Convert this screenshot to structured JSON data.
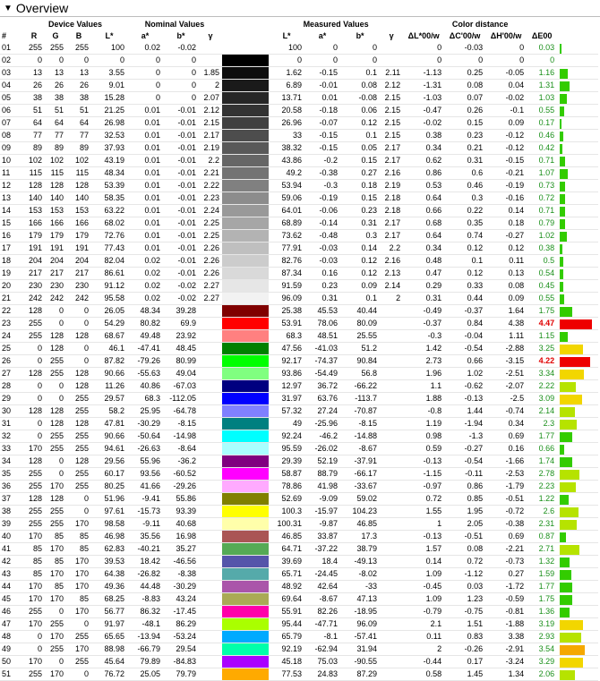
{
  "header": {
    "title": "Overview",
    "toggle_icon": "triangle-down-icon"
  },
  "groups": {
    "device": "Device Values",
    "nominal": "Nominal Values",
    "measured": "Measured Values",
    "distance": "Color distance"
  },
  "columns": [
    "#",
    "R",
    "G",
    "B",
    "L*",
    "a*",
    "b*",
    "γ",
    "",
    "L*",
    "a*",
    "b*",
    "γ",
    "ΔL*00/w",
    "ΔC'00/w",
    "ΔH'00/w",
    "ΔE00",
    ""
  ],
  "colors": {
    "bar_green": "#33cc00",
    "bar_yellowgreen": "#b6e300",
    "bar_yellow": "#f2d600",
    "bar_orange": "#f5a800",
    "bar_red": "#ee0000",
    "highlight": "#e00000"
  },
  "rows": [
    {
      "id": "01",
      "r": "255",
      "g": "255",
      "b": "255",
      "nl": "100",
      "na": "0.02",
      "nb": "-0.02",
      "ng": "",
      "swatch": "#ffffff",
      "ml": "100",
      "ma": "0",
      "mb": "0",
      "mg": "",
      "dl": "0",
      "dc": "-0.03",
      "dh": "0",
      "de": "0.03"
    },
    {
      "id": "02",
      "r": "0",
      "g": "0",
      "b": "0",
      "nl": "0",
      "na": "0",
      "nb": "0",
      "ng": "",
      "swatch": "#000000",
      "ml": "0",
      "ma": "0",
      "mb": "0",
      "mg": "",
      "dl": "0",
      "dc": "0",
      "dh": "0",
      "de": "0"
    },
    {
      "id": "03",
      "r": "13",
      "g": "13",
      "b": "13",
      "nl": "3.55",
      "na": "0",
      "nb": "0",
      "ng": "1.85",
      "swatch": "#0d0d0d",
      "ml": "1.62",
      "ma": "-0.15",
      "mb": "0.1",
      "mg": "2.11",
      "dl": "-1.13",
      "dc": "0.25",
      "dh": "-0.05",
      "de": "1.16"
    },
    {
      "id": "04",
      "r": "26",
      "g": "26",
      "b": "26",
      "nl": "9.01",
      "na": "0",
      "nb": "0",
      "ng": "2",
      "swatch": "#1a1a1a",
      "ml": "6.89",
      "ma": "-0.01",
      "mb": "0.08",
      "mg": "2.12",
      "dl": "-1.31",
      "dc": "0.08",
      "dh": "0.04",
      "de": "1.31"
    },
    {
      "id": "05",
      "r": "38",
      "g": "38",
      "b": "38",
      "nl": "15.28",
      "na": "0",
      "nb": "0",
      "ng": "2.07",
      "swatch": "#262626",
      "ml": "13.71",
      "ma": "0.01",
      "mb": "-0.08",
      "mg": "2.15",
      "dl": "-1.03",
      "dc": "0.07",
      "dh": "-0.02",
      "de": "1.03"
    },
    {
      "id": "06",
      "r": "51",
      "g": "51",
      "b": "51",
      "nl": "21.25",
      "na": "0.01",
      "nb": "-0.01",
      "ng": "2.12",
      "swatch": "#333333",
      "ml": "20.58",
      "ma": "-0.18",
      "mb": "0.06",
      "mg": "2.15",
      "dl": "-0.47",
      "dc": "0.26",
      "dh": "-0.1",
      "de": "0.55"
    },
    {
      "id": "07",
      "r": "64",
      "g": "64",
      "b": "64",
      "nl": "26.98",
      "na": "0.01",
      "nb": "-0.01",
      "ng": "2.15",
      "swatch": "#404040",
      "ml": "26.96",
      "ma": "-0.07",
      "mb": "0.12",
      "mg": "2.15",
      "dl": "-0.02",
      "dc": "0.15",
      "dh": "0.09",
      "de": "0.17"
    },
    {
      "id": "08",
      "r": "77",
      "g": "77",
      "b": "77",
      "nl": "32.53",
      "na": "0.01",
      "nb": "-0.01",
      "ng": "2.17",
      "swatch": "#4d4d4d",
      "ml": "33",
      "ma": "-0.15",
      "mb": "0.1",
      "mg": "2.15",
      "dl": "0.38",
      "dc": "0.23",
      "dh": "-0.12",
      "de": "0.46"
    },
    {
      "id": "09",
      "r": "89",
      "g": "89",
      "b": "89",
      "nl": "37.93",
      "na": "0.01",
      "nb": "-0.01",
      "ng": "2.19",
      "swatch": "#595959",
      "ml": "38.32",
      "ma": "-0.15",
      "mb": "0.05",
      "mg": "2.17",
      "dl": "0.34",
      "dc": "0.21",
      "dh": "-0.12",
      "de": "0.42"
    },
    {
      "id": "10",
      "r": "102",
      "g": "102",
      "b": "102",
      "nl": "43.19",
      "na": "0.01",
      "nb": "-0.01",
      "ng": "2.2",
      "swatch": "#666666",
      "ml": "43.86",
      "ma": "-0.2",
      "mb": "0.15",
      "mg": "2.17",
      "dl": "0.62",
      "dc": "0.31",
      "dh": "-0.15",
      "de": "0.71"
    },
    {
      "id": "11",
      "r": "115",
      "g": "115",
      "b": "115",
      "nl": "48.34",
      "na": "0.01",
      "nb": "-0.01",
      "ng": "2.21",
      "swatch": "#737373",
      "ml": "49.2",
      "ma": "-0.38",
      "mb": "0.27",
      "mg": "2.16",
      "dl": "0.86",
      "dc": "0.6",
      "dh": "-0.21",
      "de": "1.07"
    },
    {
      "id": "12",
      "r": "128",
      "g": "128",
      "b": "128",
      "nl": "53.39",
      "na": "0.01",
      "nb": "-0.01",
      "ng": "2.22",
      "swatch": "#808080",
      "ml": "53.94",
      "ma": "-0.3",
      "mb": "0.18",
      "mg": "2.19",
      "dl": "0.53",
      "dc": "0.46",
      "dh": "-0.19",
      "de": "0.73"
    },
    {
      "id": "13",
      "r": "140",
      "g": "140",
      "b": "140",
      "nl": "58.35",
      "na": "0.01",
      "nb": "-0.01",
      "ng": "2.23",
      "swatch": "#8c8c8c",
      "ml": "59.06",
      "ma": "-0.19",
      "mb": "0.15",
      "mg": "2.18",
      "dl": "0.64",
      "dc": "0.3",
      "dh": "-0.16",
      "de": "0.72"
    },
    {
      "id": "14",
      "r": "153",
      "g": "153",
      "b": "153",
      "nl": "63.22",
      "na": "0.01",
      "nb": "-0.01",
      "ng": "2.24",
      "swatch": "#999999",
      "ml": "64.01",
      "ma": "-0.06",
      "mb": "0.23",
      "mg": "2.18",
      "dl": "0.66",
      "dc": "0.22",
      "dh": "0.14",
      "de": "0.71"
    },
    {
      "id": "15",
      "r": "166",
      "g": "166",
      "b": "166",
      "nl": "68.02",
      "na": "0.01",
      "nb": "-0.01",
      "ng": "2.25",
      "swatch": "#a6a6a6",
      "ml": "68.89",
      "ma": "-0.14",
      "mb": "0.31",
      "mg": "2.17",
      "dl": "0.68",
      "dc": "0.35",
      "dh": "0.18",
      "de": "0.79"
    },
    {
      "id": "16",
      "r": "179",
      "g": "179",
      "b": "179",
      "nl": "72.76",
      "na": "0.01",
      "nb": "-0.01",
      "ng": "2.25",
      "swatch": "#b3b3b3",
      "ml": "73.62",
      "ma": "-0.48",
      "mb": "0.3",
      "mg": "2.17",
      "dl": "0.64",
      "dc": "0.74",
      "dh": "-0.27",
      "de": "1.02"
    },
    {
      "id": "17",
      "r": "191",
      "g": "191",
      "b": "191",
      "nl": "77.43",
      "na": "0.01",
      "nb": "-0.01",
      "ng": "2.26",
      "swatch": "#bfbfbf",
      "ml": "77.91",
      "ma": "-0.03",
      "mb": "0.14",
      "mg": "2.2",
      "dl": "0.34",
      "dc": "0.12",
      "dh": "0.12",
      "de": "0.38"
    },
    {
      "id": "18",
      "r": "204",
      "g": "204",
      "b": "204",
      "nl": "82.04",
      "na": "0.02",
      "nb": "-0.01",
      "ng": "2.26",
      "swatch": "#cccccc",
      "ml": "82.76",
      "ma": "-0.03",
      "mb": "0.12",
      "mg": "2.16",
      "dl": "0.48",
      "dc": "0.1",
      "dh": "0.11",
      "de": "0.5"
    },
    {
      "id": "19",
      "r": "217",
      "g": "217",
      "b": "217",
      "nl": "86.61",
      "na": "0.02",
      "nb": "-0.01",
      "ng": "2.26",
      "swatch": "#d9d9d9",
      "ml": "87.34",
      "ma": "0.16",
      "mb": "0.12",
      "mg": "2.13",
      "dl": "0.47",
      "dc": "0.12",
      "dh": "0.13",
      "de": "0.54"
    },
    {
      "id": "20",
      "r": "230",
      "g": "230",
      "b": "230",
      "nl": "91.12",
      "na": "0.02",
      "nb": "-0.02",
      "ng": "2.27",
      "swatch": "#e6e6e6",
      "ml": "91.59",
      "ma": "0.23",
      "mb": "0.09",
      "mg": "2.14",
      "dl": "0.29",
      "dc": "0.33",
      "dh": "0.08",
      "de": "0.45"
    },
    {
      "id": "21",
      "r": "242",
      "g": "242",
      "b": "242",
      "nl": "95.58",
      "na": "0.02",
      "nb": "-0.02",
      "ng": "2.27",
      "swatch": "#f2f2f2",
      "ml": "96.09",
      "ma": "0.31",
      "mb": "0.1",
      "mg": "2",
      "dl": "0.31",
      "dc": "0.44",
      "dh": "0.09",
      "de": "0.55"
    },
    {
      "id": "22",
      "r": "128",
      "g": "0",
      "b": "0",
      "nl": "26.05",
      "na": "48.34",
      "nb": "39.28",
      "ng": "",
      "swatch": "#800000",
      "ml": "25.38",
      "ma": "45.53",
      "mb": "40.44",
      "mg": "",
      "dl": "-0.49",
      "dc": "-0.37",
      "dh": "1.64",
      "de": "1.75"
    },
    {
      "id": "23",
      "r": "255",
      "g": "0",
      "b": "0",
      "nl": "54.29",
      "na": "80.82",
      "nb": "69.9",
      "ng": "",
      "swatch": "#ff0000",
      "ml": "53.91",
      "ma": "78.06",
      "mb": "80.09",
      "mg": "",
      "dl": "-0.37",
      "dc": "0.84",
      "dh": "4.38",
      "de": "4.47"
    },
    {
      "id": "24",
      "r": "255",
      "g": "128",
      "b": "128",
      "nl": "68.67",
      "na": "49.48",
      "nb": "23.92",
      "ng": "",
      "swatch": "#ff8080",
      "ml": "68.3",
      "ma": "48.51",
      "mb": "25.55",
      "mg": "",
      "dl": "-0.3",
      "dc": "-0.04",
      "dh": "1.11",
      "de": "1.15"
    },
    {
      "id": "25",
      "r": "0",
      "g": "128",
      "b": "0",
      "nl": "46.1",
      "na": "-47.41",
      "nb": "48.45",
      "ng": "",
      "swatch": "#008000",
      "ml": "47.56",
      "ma": "-41.03",
      "mb": "51.2",
      "mg": "",
      "dl": "1.42",
      "dc": "-0.54",
      "dh": "-2.88",
      "de": "3.25"
    },
    {
      "id": "26",
      "r": "0",
      "g": "255",
      "b": "0",
      "nl": "87.82",
      "na": "-79.26",
      "nb": "80.99",
      "ng": "",
      "swatch": "#00ff00",
      "ml": "92.17",
      "ma": "-74.37",
      "mb": "90.84",
      "mg": "",
      "dl": "2.73",
      "dc": "0.66",
      "dh": "-3.15",
      "de": "4.22"
    },
    {
      "id": "27",
      "r": "128",
      "g": "255",
      "b": "128",
      "nl": "90.66",
      "na": "-55.63",
      "nb": "49.04",
      "ng": "",
      "swatch": "#80ff80",
      "ml": "93.86",
      "ma": "-54.49",
      "mb": "56.8",
      "mg": "",
      "dl": "1.96",
      "dc": "1.02",
      "dh": "-2.51",
      "de": "3.34"
    },
    {
      "id": "28",
      "r": "0",
      "g": "0",
      "b": "128",
      "nl": "11.26",
      "na": "40.86",
      "nb": "-67.03",
      "ng": "",
      "swatch": "#000080",
      "ml": "12.97",
      "ma": "36.72",
      "mb": "-66.22",
      "mg": "",
      "dl": "1.1",
      "dc": "-0.62",
      "dh": "-2.07",
      "de": "2.22"
    },
    {
      "id": "29",
      "r": "0",
      "g": "0",
      "b": "255",
      "nl": "29.57",
      "na": "68.3",
      "nb": "-112.05",
      "ng": "",
      "swatch": "#0000ff",
      "ml": "31.97",
      "ma": "63.76",
      "mb": "-113.7",
      "mg": "",
      "dl": "1.88",
      "dc": "-0.13",
      "dh": "-2.5",
      "de": "3.09"
    },
    {
      "id": "30",
      "r": "128",
      "g": "128",
      "b": "255",
      "nl": "58.2",
      "na": "25.95",
      "nb": "-64.78",
      "ng": "",
      "swatch": "#8080ff",
      "ml": "57.32",
      "ma": "27.24",
      "mb": "-70.87",
      "mg": "",
      "dl": "-0.8",
      "dc": "1.44",
      "dh": "-0.74",
      "de": "2.14"
    },
    {
      "id": "31",
      "r": "0",
      "g": "128",
      "b": "128",
      "nl": "47.81",
      "na": "-30.29",
      "nb": "-8.15",
      "ng": "",
      "swatch": "#008080",
      "ml": "49",
      "ma": "-25.96",
      "mb": "-8.15",
      "mg": "",
      "dl": "1.19",
      "dc": "-1.94",
      "dh": "0.34",
      "de": "2.3"
    },
    {
      "id": "32",
      "r": "0",
      "g": "255",
      "b": "255",
      "nl": "90.66",
      "na": "-50.64",
      "nb": "-14.98",
      "ng": "",
      "swatch": "#00ffff",
      "ml": "92.24",
      "ma": "-46.2",
      "mb": "-14.88",
      "mg": "",
      "dl": "0.98",
      "dc": "-1.3",
      "dh": "0.69",
      "de": "1.77"
    },
    {
      "id": "33",
      "r": "170",
      "g": "255",
      "b": "255",
      "nl": "94.61",
      "na": "-26.63",
      "nb": "-8.64",
      "ng": "",
      "swatch": "#aaffff",
      "ml": "95.59",
      "ma": "-26.02",
      "mb": "-8.67",
      "mg": "",
      "dl": "0.59",
      "dc": "-0.27",
      "dh": "0.16",
      "de": "0.66"
    },
    {
      "id": "34",
      "r": "128",
      "g": "0",
      "b": "128",
      "nl": "29.56",
      "na": "55.96",
      "nb": "-36.2",
      "ng": "",
      "swatch": "#800080",
      "ml": "29.39",
      "ma": "52.19",
      "mb": "-37.91",
      "mg": "",
      "dl": "-0.13",
      "dc": "-0.54",
      "dh": "-1.66",
      "de": "1.74"
    },
    {
      "id": "35",
      "r": "255",
      "g": "0",
      "b": "255",
      "nl": "60.17",
      "na": "93.56",
      "nb": "-60.52",
      "ng": "",
      "swatch": "#ff00ff",
      "ml": "58.87",
      "ma": "88.79",
      "mb": "-66.17",
      "mg": "",
      "dl": "-1.15",
      "dc": "-0.11",
      "dh": "-2.53",
      "de": "2.78"
    },
    {
      "id": "36",
      "r": "255",
      "g": "170",
      "b": "255",
      "nl": "80.25",
      "na": "41.66",
      "nb": "-29.26",
      "ng": "",
      "swatch": "#ffaaff",
      "ml": "78.86",
      "ma": "41.98",
      "mb": "-33.67",
      "mg": "",
      "dl": "-0.97",
      "dc": "0.86",
      "dh": "-1.79",
      "de": "2.23"
    },
    {
      "id": "37",
      "r": "128",
      "g": "128",
      "b": "0",
      "nl": "51.96",
      "na": "-9.41",
      "nb": "55.86",
      "ng": "",
      "swatch": "#808000",
      "ml": "52.69",
      "ma": "-9.09",
      "mb": "59.02",
      "mg": "",
      "dl": "0.72",
      "dc": "0.85",
      "dh": "-0.51",
      "de": "1.22"
    },
    {
      "id": "38",
      "r": "255",
      "g": "255",
      "b": "0",
      "nl": "97.61",
      "na": "-15.73",
      "nb": "93.39",
      "ng": "",
      "swatch": "#ffff00",
      "ml": "100.3",
      "ma": "-15.97",
      "mb": "104.23",
      "mg": "",
      "dl": "1.55",
      "dc": "1.95",
      "dh": "-0.72",
      "de": "2.6"
    },
    {
      "id": "39",
      "r": "255",
      "g": "255",
      "b": "170",
      "nl": "98.58",
      "na": "-9.11",
      "nb": "40.68",
      "ng": "",
      "swatch": "#ffffaa",
      "ml": "100.31",
      "ma": "-9.87",
      "mb": "46.85",
      "mg": "",
      "dl": "1",
      "dc": "2.05",
      "dh": "-0.38",
      "de": "2.31"
    },
    {
      "id": "40",
      "r": "170",
      "g": "85",
      "b": "85",
      "nl": "46.98",
      "na": "35.56",
      "nb": "16.98",
      "ng": "",
      "swatch": "#aa5555",
      "ml": "46.85",
      "ma": "33.87",
      "mb": "17.3",
      "mg": "",
      "dl": "-0.13",
      "dc": "-0.51",
      "dh": "0.69",
      "de": "0.87"
    },
    {
      "id": "41",
      "r": "85",
      "g": "170",
      "b": "85",
      "nl": "62.83",
      "na": "-40.21",
      "nb": "35.27",
      "ng": "",
      "swatch": "#55aa55",
      "ml": "64.71",
      "ma": "-37.22",
      "mb": "38.79",
      "mg": "",
      "dl": "1.57",
      "dc": "0.08",
      "dh": "-2.21",
      "de": "2.71"
    },
    {
      "id": "42",
      "r": "85",
      "g": "85",
      "b": "170",
      "nl": "39.53",
      "na": "18.42",
      "nb": "-46.56",
      "ng": "",
      "swatch": "#5555aa",
      "ml": "39.69",
      "ma": "18.4",
      "mb": "-49.13",
      "mg": "",
      "dl": "0.14",
      "dc": "0.72",
      "dh": "-0.73",
      "de": "1.32"
    },
    {
      "id": "43",
      "r": "85",
      "g": "170",
      "b": "170",
      "nl": "64.38",
      "na": "-26.82",
      "nb": "-8.38",
      "ng": "",
      "swatch": "#55aaaa",
      "ml": "65.71",
      "ma": "-24.45",
      "mb": "-8.02",
      "mg": "",
      "dl": "1.09",
      "dc": "-1.12",
      "dh": "0.27",
      "de": "1.59"
    },
    {
      "id": "44",
      "r": "170",
      "g": "85",
      "b": "170",
      "nl": "49.36",
      "na": "44.48",
      "nb": "-30.29",
      "ng": "",
      "swatch": "#aa55aa",
      "ml": "48.92",
      "ma": "42.64",
      "mb": "-33",
      "mg": "",
      "dl": "-0.45",
      "dc": "0.03",
      "dh": "-1.72",
      "de": "1.77"
    },
    {
      "id": "45",
      "r": "170",
      "g": "170",
      "b": "85",
      "nl": "68.25",
      "na": "-8.83",
      "nb": "43.24",
      "ng": "",
      "swatch": "#aaaa55",
      "ml": "69.64",
      "ma": "-8.67",
      "mb": "47.13",
      "mg": "",
      "dl": "1.09",
      "dc": "1.23",
      "dh": "-0.59",
      "de": "1.75"
    },
    {
      "id": "46",
      "r": "255",
      "g": "0",
      "b": "170",
      "nl": "56.77",
      "na": "86.32",
      "nb": "-17.45",
      "ng": "",
      "swatch": "#ff00aa",
      "ml": "55.91",
      "ma": "82.26",
      "mb": "-18.95",
      "mg": "",
      "dl": "-0.79",
      "dc": "-0.75",
      "dh": "-0.81",
      "de": "1.36"
    },
    {
      "id": "47",
      "r": "170",
      "g": "255",
      "b": "0",
      "nl": "91.97",
      "na": "-48.1",
      "nb": "86.29",
      "ng": "",
      "swatch": "#aaff00",
      "ml": "95.44",
      "ma": "-47.71",
      "mb": "96.09",
      "mg": "",
      "dl": "2.1",
      "dc": "1.51",
      "dh": "-1.88",
      "de": "3.19"
    },
    {
      "id": "48",
      "r": "0",
      "g": "170",
      "b": "255",
      "nl": "65.65",
      "na": "-13.94",
      "nb": "-53.24",
      "ng": "",
      "swatch": "#00aaff",
      "ml": "65.79",
      "ma": "-8.1",
      "mb": "-57.41",
      "mg": "",
      "dl": "0.11",
      "dc": "0.83",
      "dh": "3.38",
      "de": "2.93"
    },
    {
      "id": "49",
      "r": "0",
      "g": "255",
      "b": "170",
      "nl": "88.98",
      "na": "-66.79",
      "nb": "29.54",
      "ng": "",
      "swatch": "#00ffaa",
      "ml": "92.19",
      "ma": "-62.94",
      "mb": "31.94",
      "mg": "",
      "dl": "2",
      "dc": "-0.26",
      "dh": "-2.91",
      "de": "3.54"
    },
    {
      "id": "50",
      "r": "170",
      "g": "0",
      "b": "255",
      "nl": "45.64",
      "na": "79.89",
      "nb": "-84.83",
      "ng": "",
      "swatch": "#aa00ff",
      "ml": "45.18",
      "ma": "75.03",
      "mb": "-90.55",
      "mg": "",
      "dl": "-0.44",
      "dc": "0.17",
      "dh": "-3.24",
      "de": "3.29"
    },
    {
      "id": "51",
      "r": "255",
      "g": "170",
      "b": "0",
      "nl": "76.72",
      "na": "25.05",
      "nb": "79.79",
      "ng": "",
      "swatch": "#ffaa00",
      "ml": "77.53",
      "ma": "24.83",
      "mb": "87.29",
      "mg": "",
      "dl": "0.58",
      "dc": "1.45",
      "dh": "1.34",
      "de": "2.06"
    }
  ]
}
